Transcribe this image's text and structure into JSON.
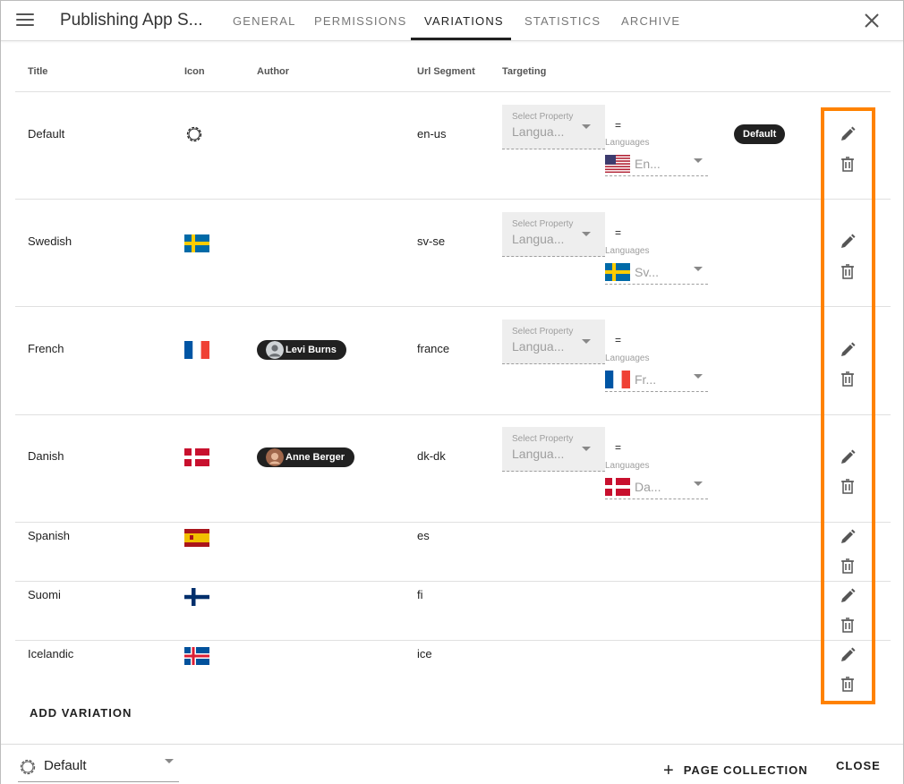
{
  "header": {
    "app_title": "Publishing App S...",
    "tabs": [
      {
        "label": "GENERAL"
      },
      {
        "label": "PERMISSIONS"
      },
      {
        "label": "VARIATIONS"
      },
      {
        "label": "STATISTICS"
      },
      {
        "label": "ARCHIVE"
      }
    ],
    "active_tab": "VARIATIONS"
  },
  "table": {
    "columns": [
      "Title",
      "Icon",
      "Author",
      "Url Segment",
      "Targeting"
    ],
    "rows": [
      {
        "title": "Default",
        "icon": "gear-icon",
        "author": "",
        "url_segment": "en-us",
        "targeting": {
          "property_label": "Select Property",
          "property_value": "Langua...",
          "operator": "=",
          "languages_label": "Languages",
          "language_value": "En...",
          "language_flag": "us-flag"
        },
        "badge": "Default"
      },
      {
        "title": "Swedish",
        "icon": "sweden-flag",
        "author": "",
        "url_segment": "sv-se",
        "targeting": {
          "property_label": "Select Property",
          "property_value": "Langua...",
          "operator": "=",
          "languages_label": "Languages",
          "language_value": "Sv...",
          "language_flag": "sweden-flag"
        }
      },
      {
        "title": "French",
        "icon": "france-flag",
        "author": "Levi Burns",
        "url_segment": "france",
        "targeting": {
          "property_label": "Select Property",
          "property_value": "Langua...",
          "operator": "=",
          "languages_label": "Languages",
          "language_value": "Fr...",
          "language_flag": "france-flag"
        }
      },
      {
        "title": "Danish",
        "icon": "denmark-flag",
        "author": "Anne Berger",
        "url_segment": "dk-dk",
        "targeting": {
          "property_label": "Select Property",
          "property_value": "Langua...",
          "operator": "=",
          "languages_label": "Languages",
          "language_value": "Da...",
          "language_flag": "denmark-flag"
        }
      },
      {
        "title": "Spanish",
        "icon": "spain-flag",
        "author": "",
        "url_segment": "es"
      },
      {
        "title": "Suomi",
        "icon": "finland-flag",
        "author": "",
        "url_segment": "fi"
      },
      {
        "title": "Icelandic",
        "icon": "iceland-flag",
        "author": "",
        "url_segment": "ice"
      }
    ]
  },
  "add_variation_label": "ADD VARIATION",
  "footer": {
    "variation_select_value": "Default",
    "page_collection_label": "PAGE COLLECTION",
    "close_label": "CLOSE"
  },
  "colors": {
    "highlight": "#ff8200",
    "chip_bg": "#212121"
  }
}
